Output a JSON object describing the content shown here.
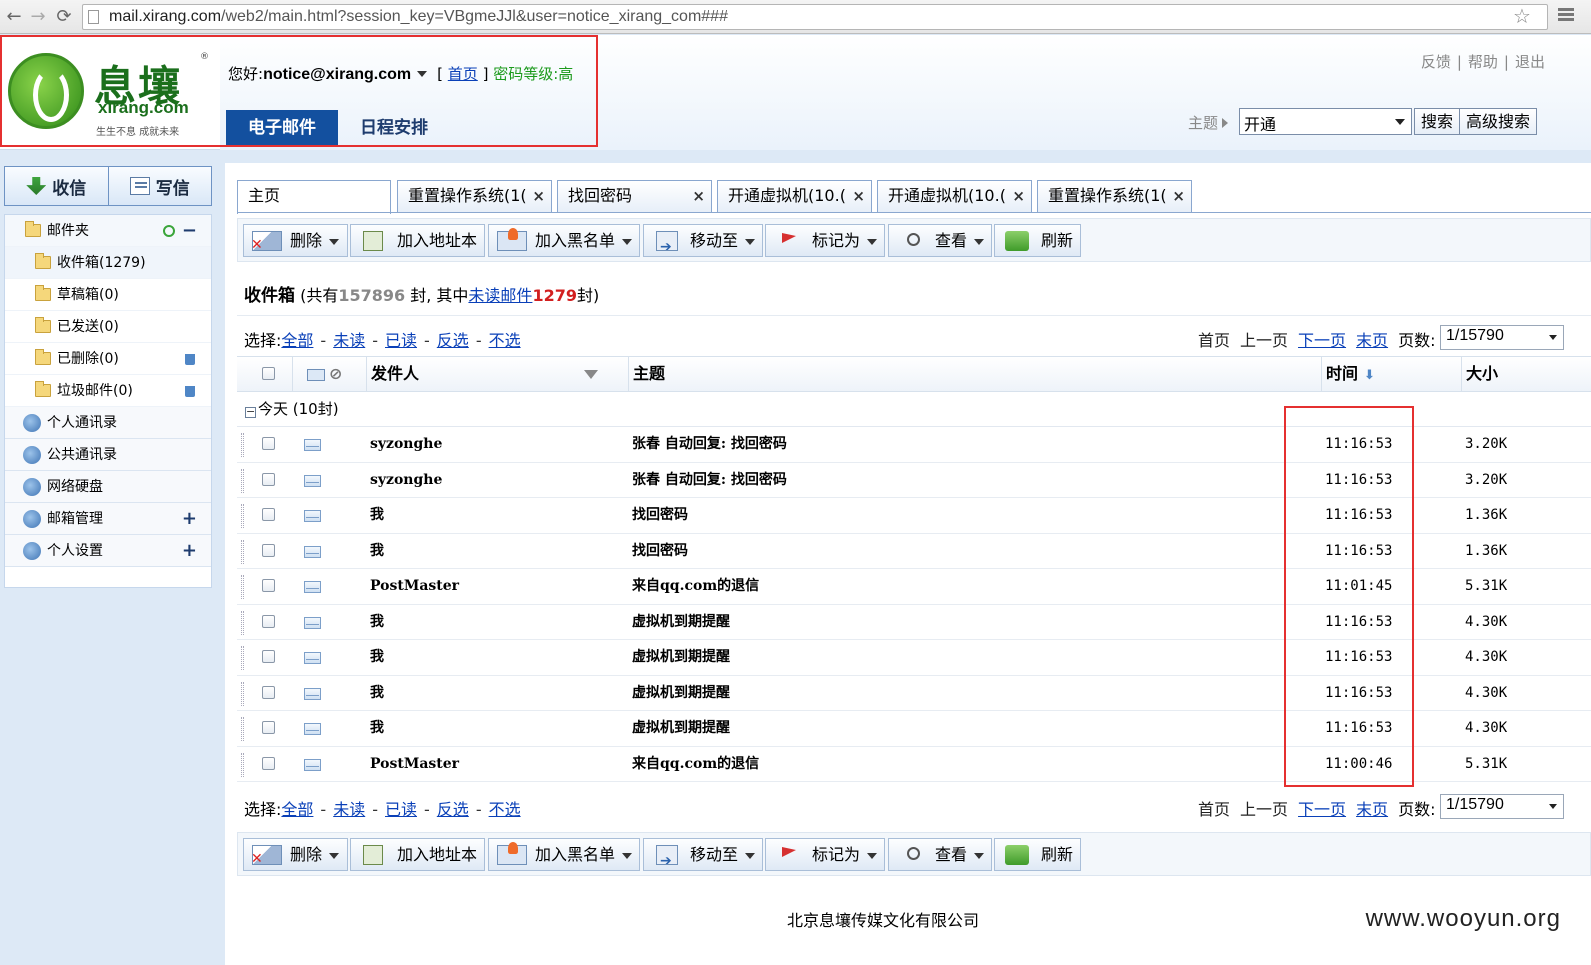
{
  "browser": {
    "url_domain": "mail.xirang.com",
    "url_path": "/web2/main.html?session_key=VBgmeJJl&user=notice_xirang_com###"
  },
  "header": {
    "logo_cn": "息壤",
    "logo_en": "xirang.com",
    "logo_slogan": "生生不息  成就未来",
    "greeting_prefix": "您好:",
    "user_email": "notice@xirang.com",
    "home_link": "首页",
    "bracket_open": "[",
    "bracket_close": "]",
    "password_level": "密码等级:高",
    "tabs": [
      {
        "label": "电子邮件",
        "active": true
      },
      {
        "label": "日程安排",
        "active": false
      }
    ],
    "top_links": [
      "反馈",
      "帮助",
      "退出"
    ],
    "search": {
      "field_label": "主题",
      "value": "开通",
      "search_button": "搜索",
      "advanced_button": "高级搜索"
    }
  },
  "sidebar": {
    "receive_label": "收信",
    "write_label": "写信",
    "folders_title": "邮件夹",
    "folders": [
      {
        "name": "收件箱",
        "count": "(1279)"
      },
      {
        "name": "草稿箱",
        "count": "(0)"
      },
      {
        "name": "已发送",
        "count": "(0)"
      },
      {
        "name": "已删除",
        "count": "(0)"
      },
      {
        "name": "垃圾邮件",
        "count": "(0)"
      }
    ],
    "sections": [
      {
        "label": "个人通讯录"
      },
      {
        "label": "公共通讯录"
      },
      {
        "label": "网络硬盘"
      },
      {
        "label": "邮箱管理"
      },
      {
        "label": "个人设置"
      }
    ]
  },
  "tabs": [
    {
      "label": "主页"
    },
    {
      "label": "重置操作系统(1("
    },
    {
      "label": "找回密码"
    },
    {
      "label": "开通虚拟机(10.("
    },
    {
      "label": "开通虚拟机(10.("
    },
    {
      "label": "重置操作系统(1("
    }
  ],
  "toolbar": {
    "delete": "删除",
    "add_address": "加入地址本",
    "add_blacklist": "加入黑名单",
    "move_to": "移动至",
    "mark_as": "标记为",
    "view": "查看",
    "refresh": "刷新"
  },
  "inbox": {
    "title": "收件箱",
    "summary_prefix": "(共有",
    "total": "157896",
    "summary_mid": "封, 其中",
    "unread_link": "未读邮件",
    "unread": "1279",
    "summary_suffix": "封)"
  },
  "selection": {
    "label": "选择:",
    "options": [
      "全部",
      "未读",
      "已读",
      "反选",
      "不选"
    ]
  },
  "pager": {
    "first": "首页",
    "prev": "上一页",
    "next": "下一页",
    "last": "末页",
    "pages_label": "页数:",
    "current": "1/15790"
  },
  "table": {
    "columns": {
      "sender": "发件人",
      "subject": "主题",
      "time": "时间",
      "size": "大小"
    },
    "group_label": "今天 (10封)",
    "rows": [
      {
        "sender": "syzonghe",
        "subject": "张春 自动回复: 找回密码",
        "time": "11:16:53",
        "size": "3.20K"
      },
      {
        "sender": "syzonghe",
        "subject": "张春 自动回复: 找回密码",
        "time": "11:16:53",
        "size": "3.20K"
      },
      {
        "sender": "我",
        "subject": "找回密码",
        "time": "11:16:53",
        "size": "1.36K"
      },
      {
        "sender": "我",
        "subject": "找回密码",
        "time": "11:16:53",
        "size": "1.36K"
      },
      {
        "sender": "PostMaster",
        "subject": "来自qq.com的退信",
        "time": "11:01:45",
        "size": "5.31K"
      },
      {
        "sender": "我",
        "subject": "虚拟机到期提醒",
        "time": "11:16:53",
        "size": "4.30K"
      },
      {
        "sender": "我",
        "subject": "虚拟机到期提醒",
        "time": "11:16:53",
        "size": "4.30K"
      },
      {
        "sender": "我",
        "subject": "虚拟机到期提醒",
        "time": "11:16:53",
        "size": "4.30K"
      },
      {
        "sender": "我",
        "subject": "虚拟机到期提醒",
        "time": "11:16:53",
        "size": "4.30K"
      },
      {
        "sender": "PostMaster",
        "subject": "来自qq.com的退信",
        "time": "11:00:46",
        "size": "5.31K"
      }
    ]
  },
  "footer": {
    "company": "北京息壤传媒文化有限公司"
  },
  "watermark": "www.wooyun.org",
  "colors": {
    "accent_blue": "#13509f",
    "highlight_red": "#e53030",
    "unread_red": "#d21f1f",
    "password_green": "#1c9a1c"
  }
}
